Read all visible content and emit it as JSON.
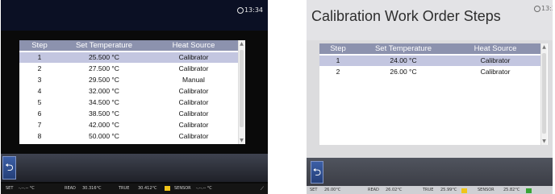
{
  "left": {
    "clock": "13:34",
    "table": {
      "headers": [
        "Step",
        "Set Temperature",
        "Heat Source"
      ],
      "rows": [
        [
          "1",
          "25.500 °C",
          "Calibrator"
        ],
        [
          "2",
          "27.500 °C",
          "Calibrator"
        ],
        [
          "3",
          "29.500 °C",
          "Manual"
        ],
        [
          "4",
          "32.000 °C",
          "Calibrator"
        ],
        [
          "5",
          "34.500 °C",
          "Calibrator"
        ],
        [
          "6",
          "38.500 °C",
          "Calibrator"
        ],
        [
          "7",
          "42.000 °C",
          "Calibrator"
        ],
        [
          "8",
          "50.000 °C",
          "Calibrator"
        ]
      ],
      "selected_row": 0
    },
    "back_glyph": "⮌",
    "status": {
      "set_label": "SET",
      "set_value": "-.--.-- °C",
      "read_label": "READ",
      "read_value": "30.316°C",
      "true_label": "TRUE",
      "true_value": "30.412°C",
      "sensor_label": "SENSOR",
      "sensor_value": "-.--.-- °C"
    }
  },
  "right": {
    "title": "Calibration Work Order Steps",
    "clock": "13:3",
    "table": {
      "headers": [
        "Step",
        "Set Temperature",
        "Heat Source"
      ],
      "rows": [
        [
          "1",
          "24.00 °C",
          "Calibrator"
        ],
        [
          "2",
          "26.00 °C",
          "Calibrator"
        ]
      ],
      "selected_row": 0
    },
    "back_glyph": "⮌",
    "status": {
      "set_label": "SET",
      "set_value": "26.00°C",
      "read_label": "READ",
      "read_value": "26.02°C",
      "true_label": "TRUE",
      "true_value": "25.99°C",
      "sensor_label": "SENSOR",
      "sensor_value": "25.82°C"
    }
  },
  "colors": {
    "header_bg": "#8c92ae",
    "selected_row_bg": "#c3c6e0",
    "warn_badge": "#f0c419",
    "ok_badge": "#3aa335",
    "back_button": "#2f4f91"
  }
}
